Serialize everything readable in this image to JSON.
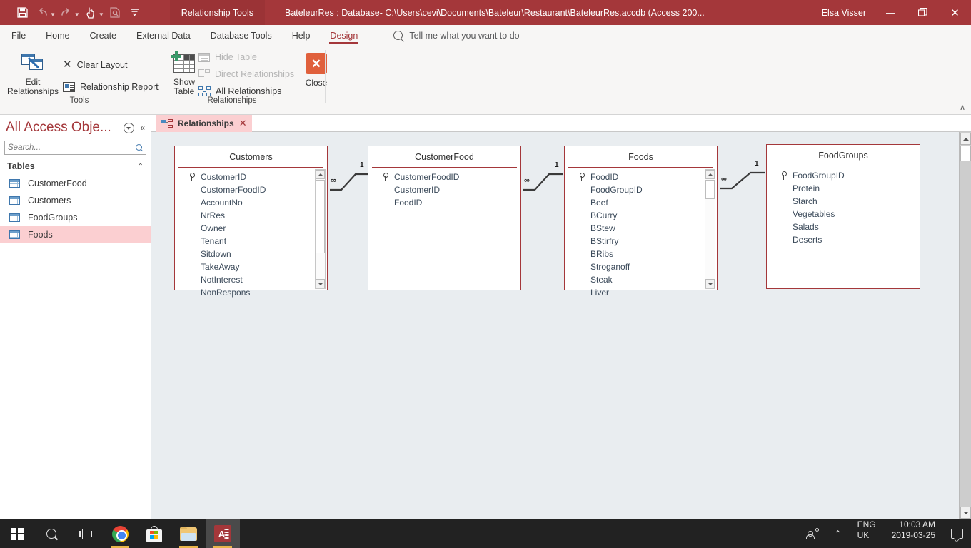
{
  "titlebar": {
    "context_tab": "Relationship Tools",
    "document_title": "BateleurRes : Database- C:\\Users\\cevi\\Documents\\Bateleur\\Restaurant\\BateleurRes.accdb (Access 200...",
    "user_name": "Elsa Visser",
    "quick_access": [
      {
        "name": "save-icon",
        "glyph": "💾"
      },
      {
        "name": "undo-icon",
        "glyph": "↶"
      },
      {
        "name": "redo-icon",
        "glyph": "↷"
      },
      {
        "name": "touch-mode-icon",
        "glyph": "☝"
      },
      {
        "name": "print-preview-icon",
        "glyph": "🗎"
      },
      {
        "name": "customize-quick-access-icon",
        "glyph": "☰"
      }
    ],
    "window_buttons": {
      "minimize": "—",
      "restore": "❐",
      "close": "✕"
    }
  },
  "ribbon_tabs": {
    "items": [
      {
        "label": "File",
        "active": false
      },
      {
        "label": "Home",
        "active": false
      },
      {
        "label": "Create",
        "active": false
      },
      {
        "label": "External Data",
        "active": false
      },
      {
        "label": "Database Tools",
        "active": false
      },
      {
        "label": "Help",
        "active": false
      },
      {
        "label": "Design",
        "active": true
      }
    ],
    "tell_me_placeholder": "Tell me what you want to do",
    "collapse_glyph": "∧"
  },
  "ribbon": {
    "groups": [
      {
        "name": "Tools",
        "label": "Tools",
        "buttons": [
          {
            "id": "edit-relationships",
            "label_line1": "Edit",
            "label_line2": "Relationships",
            "disabled": false
          },
          {
            "id": "clear-layout",
            "label": "Clear Layout",
            "disabled": false
          },
          {
            "id": "relationship-report",
            "label": "Relationship Report",
            "disabled": false
          }
        ]
      },
      {
        "name": "Relationships",
        "label": "Relationships",
        "buttons": [
          {
            "id": "show-table",
            "label_line1": "Show",
            "label_line2": "Table",
            "disabled": false
          },
          {
            "id": "hide-table",
            "label": "Hide Table",
            "disabled": true
          },
          {
            "id": "direct-relationships",
            "label": "Direct Relationships",
            "disabled": true
          },
          {
            "id": "all-relationships",
            "label": "All Relationships",
            "disabled": false
          },
          {
            "id": "close",
            "label": "Close",
            "disabled": false
          }
        ]
      }
    ]
  },
  "navpane": {
    "title": "All Access Obje...",
    "search_placeholder": "Search...",
    "group_label": "Tables",
    "items": [
      {
        "label": "CustomerFood",
        "selected": false
      },
      {
        "label": "Customers",
        "selected": false
      },
      {
        "label": "FoodGroups",
        "selected": false
      },
      {
        "label": "Foods",
        "selected": true
      }
    ]
  },
  "document_tabs": [
    {
      "label": "Relationships",
      "active": true,
      "close_glyph": "✕"
    }
  ],
  "canvas": {
    "tables": [
      {
        "name": "Customers",
        "fields": [
          "CustomerID",
          "CustomerFoodID",
          "AccountNo",
          "NrRes",
          "Owner",
          "Tenant",
          "Sitdown",
          "TakeAway",
          "NotInterest",
          "NonRespons"
        ],
        "primary_key": "CustomerID",
        "has_scrollbar": true,
        "scroll_thumb_ratio": 0.62
      },
      {
        "name": "CustomerFood",
        "fields": [
          "CustomerFoodID",
          "CustomerID",
          "FoodID"
        ],
        "primary_key": "CustomerFoodID",
        "has_scrollbar": false,
        "scroll_thumb_ratio": 0
      },
      {
        "name": "Foods",
        "fields": [
          "FoodID",
          "FoodGroupID",
          "Beef",
          "BCurry",
          "BStew",
          "BStirfry",
          "BRibs",
          "Stroganoff",
          "Steak",
          "Liver"
        ],
        "primary_key": "FoodID",
        "has_scrollbar": true,
        "scroll_thumb_ratio": 0.16
      },
      {
        "name": "FoodGroups",
        "fields": [
          "FoodGroupID",
          "Protein",
          "Starch",
          "Vegetables",
          "Salads",
          "Deserts"
        ],
        "primary_key": "FoodGroupID",
        "has_scrollbar": false,
        "scroll_thumb_ratio": 0
      }
    ],
    "relationships": [
      {
        "from": "Customers",
        "to": "CustomerFood",
        "one_label": "1",
        "many_label": "∞"
      },
      {
        "from": "CustomerFood",
        "to": "Foods",
        "one_label": "1",
        "many_label": "∞"
      },
      {
        "from": "Foods",
        "to": "FoodGroups",
        "one_label": "1",
        "many_label": "∞"
      }
    ]
  },
  "taskbar": {
    "items": [
      {
        "name": "start-button",
        "label": "Start"
      },
      {
        "name": "search-button",
        "label": "Search"
      },
      {
        "name": "task-view-button",
        "label": "Task View"
      },
      {
        "name": "chrome-button",
        "label": "Google Chrome",
        "running": true
      },
      {
        "name": "microsoft-store-button",
        "label": "Microsoft Store",
        "running": false
      },
      {
        "name": "file-explorer-button",
        "label": "File Explorer",
        "running": true
      },
      {
        "name": "access-button",
        "label": "Microsoft Access",
        "running": true,
        "active": true
      }
    ],
    "tray": {
      "language_line1": "ENG",
      "language_line2": "UK",
      "time": "10:03 AM",
      "date": "2019-03-25"
    }
  },
  "colors": {
    "accent": "#a4373a",
    "ribbon_bg": "#f7f6f5",
    "canvas_bg": "#e9edf0",
    "selection": "#fbcfd1",
    "close_icon": "#e0603c",
    "taskbar": "#222222"
  }
}
